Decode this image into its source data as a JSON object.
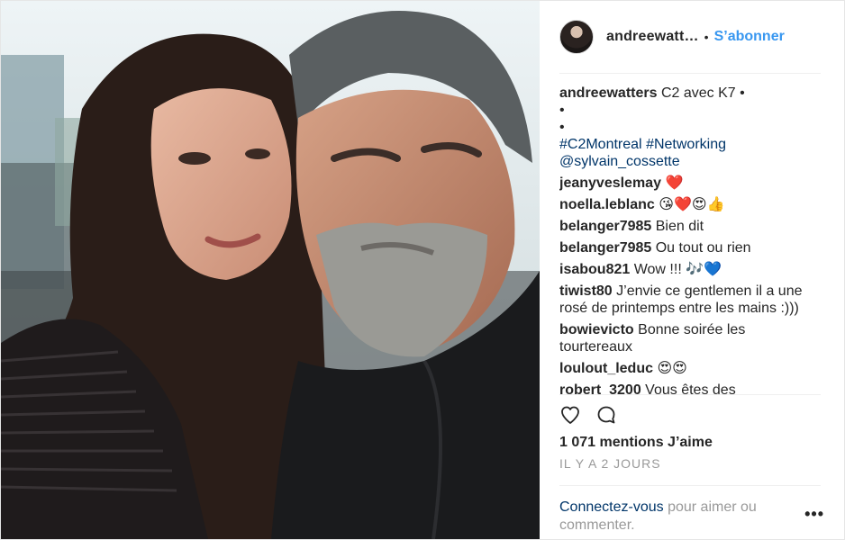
{
  "header": {
    "username": "andreewatt…",
    "separator": "•",
    "follow_label": "S’abonner"
  },
  "caption": {
    "username": "andreewatters",
    "line1": "C2 avec K7 •",
    "line2": "•",
    "line3": "•",
    "hashtag1": "#C2Montreal",
    "hashtag2": "#Networking",
    "mention": "@sylvain_cossette"
  },
  "comments": [
    {
      "user": "jeanyveslemay",
      "text": "",
      "emoji": "❤️"
    },
    {
      "user": "noella.leblanc",
      "text": "",
      "emoji": "😘❤️😍👍"
    },
    {
      "user": "belanger7985",
      "text": "Bien dit",
      "emoji": ""
    },
    {
      "user": "belanger7985",
      "text": "Ou tout ou rien",
      "emoji": ""
    },
    {
      "user": "isabou821",
      "text": "Wow !!!",
      "emoji": "🎶💙"
    },
    {
      "user": "tiwist80",
      "text": "J’envie ce gentlemen il a une rosé de printemps entre les mains :)))",
      "emoji": ""
    },
    {
      "user": "bowievicto",
      "text": "Bonne soirée les tourtereaux",
      "emoji": ""
    },
    {
      "user": "loulout_leduc",
      "text": "",
      "emoji": "😍😍"
    },
    {
      "user": "robert_3200",
      "text": "Vous êtes des",
      "emoji": ""
    }
  ],
  "likes": "1 071 mentions J’aime",
  "time": "IL Y A 2 JOURS",
  "footer": {
    "login": "Connectez-vous",
    "rest": " pour aimer ou commenter.",
    "more": "•••"
  },
  "icons": {
    "like": "heart-outline-icon",
    "comment": "comment-bubble-icon",
    "more": "more-options-icon"
  },
  "colors": {
    "accent": "#3897f0",
    "link": "#003569",
    "muted": "#999999"
  }
}
